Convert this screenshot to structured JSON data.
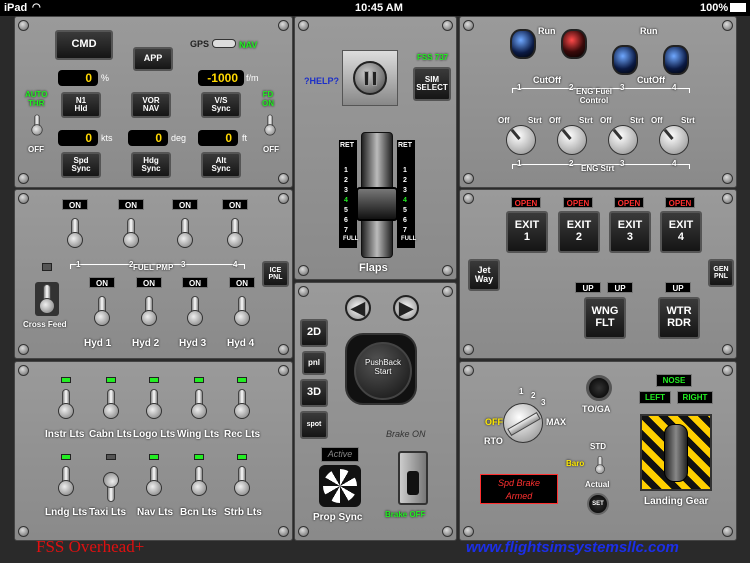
{
  "status": {
    "device": "iPad",
    "time": "10:45 AM",
    "battery": "100%"
  },
  "autopilot": {
    "cmd": "CMD",
    "gps": "GPS",
    "nav": "NAV",
    "app": "APP",
    "n1": "N1\nHld",
    "vornav": "VOR\nNAV",
    "vs_sync": "V/S\nSync",
    "n1_val": "0",
    "n1_unit": "%",
    "vs_val": "-1000",
    "vs_unit": "f/m",
    "spd_val": "0",
    "spd_unit": "kts",
    "hdg_val": "0",
    "hdg_unit": "deg",
    "alt_val": "0",
    "alt_unit": "ft",
    "spd_sync": "Spd\nSync",
    "hdg_sync": "Hdg\nSync",
    "alt_sync": "Alt\nSync",
    "left_top": "AUTO\nTHR",
    "left_bot": "OFF",
    "right_top": "FD\nON",
    "right_bot": "OFF"
  },
  "center": {
    "help": "?HELP?",
    "sim_select": "SIM\nSELECT",
    "sim_label": "FSS 737",
    "flap_ret": "RET",
    "flap_full": "FULL",
    "flap_nums": [
      "1",
      "2",
      "3",
      "4",
      "5",
      "6",
      "7"
    ],
    "flaps": "Flaps"
  },
  "eng": {
    "run": "Run",
    "cutoff": "CutOff",
    "eng_fuel": "ENG Fuel\nControl",
    "off": "Off",
    "strt": "Strt",
    "eng_strt": "ENG Strt",
    "n": [
      "1",
      "2",
      "3",
      "4"
    ]
  },
  "fuel": {
    "on": "ON",
    "fuel_pmp": "FUEL PMP",
    "cross_feed": "Cross Feed",
    "ice_pnl": "ICE\nPNL",
    "hyd": [
      "Hyd 1",
      "Hyd 2",
      "Hyd 3",
      "Hyd 4"
    ],
    "pump_n": [
      "1",
      "2",
      "3",
      "4"
    ]
  },
  "doors": {
    "open": "OPEN",
    "exits": [
      "EXIT\n1",
      "EXIT\n2",
      "EXIT\n3",
      "EXIT\n4"
    ],
    "jetway": "Jet\nWay",
    "gen_pnl": "GEN\nPNL",
    "up": "UP",
    "wng": "WNG\nFLT",
    "wtr": "WTR\nRDR"
  },
  "lights": {
    "top": [
      "Instr Lts",
      "Cabn Lts",
      "Logo Lts",
      "Wing Lts",
      "Rec Lts"
    ],
    "bot": [
      "Lndg Lts",
      "Taxi Lts",
      "Nav Lts",
      "Bcn Lts",
      "Strb Lts"
    ]
  },
  "view": {
    "v2d": "2D",
    "pnl": "pnl",
    "v3d": "3D",
    "spot": "spot",
    "pushback": "PushBack\nStart",
    "brake": "Brake ON",
    "active": "Active",
    "prop_sync": "Prop Sync",
    "brake_off": "Brake OFF"
  },
  "gear": {
    "off": "OFF",
    "one": "1",
    "two": "2",
    "three": "3",
    "max": "MAX",
    "rto": "RTO",
    "toga": "TO/GA",
    "spd_brake": "Spd Brake\nArmed",
    "std": "STD",
    "baro": "Baro",
    "actual": "Actual",
    "set": "SET",
    "nose": "NOSE",
    "left": "LEFT",
    "right": "RIGHT",
    "landing_gear": "Landing Gear"
  },
  "footer": {
    "app_name": "FSS Overhead+",
    "website": "www.flightsimsystemsllc.com"
  }
}
